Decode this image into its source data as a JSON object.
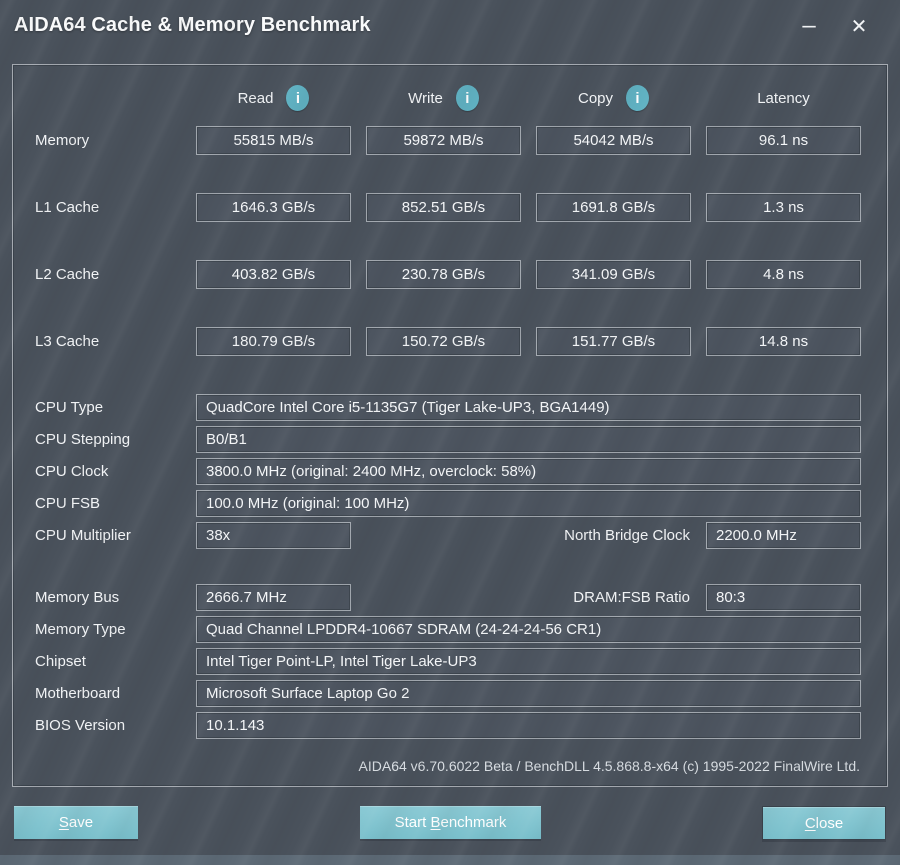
{
  "window": {
    "title": "AIDA64 Cache & Memory Benchmark",
    "minimize_glyph": "–",
    "close_glyph": "✕"
  },
  "colors": {
    "accent_teal": "#7cc1cd",
    "info_icon_teal": "#60b1c2",
    "window_bg": "#4a525c",
    "box_border": "#a2a8af",
    "bottom_strip": "#5d6a76"
  },
  "benchmark": {
    "headers": {
      "read": "Read",
      "write": "Write",
      "copy": "Copy",
      "latency": "Latency",
      "info_glyph": "i"
    },
    "rows": [
      {
        "label": "Memory",
        "read": "55815 MB/s",
        "write": "59872 MB/s",
        "copy": "54042 MB/s",
        "latency": "96.1 ns"
      },
      {
        "label": "L1 Cache",
        "read": "1646.3 GB/s",
        "write": "852.51 GB/s",
        "copy": "1691.8 GB/s",
        "latency": "1.3 ns"
      },
      {
        "label": "L2 Cache",
        "read": "403.82 GB/s",
        "write": "230.78 GB/s",
        "copy": "341.09 GB/s",
        "latency": "4.8 ns"
      },
      {
        "label": "L3 Cache",
        "read": "180.79 GB/s",
        "write": "150.72 GB/s",
        "copy": "151.77 GB/s",
        "latency": "14.8 ns"
      }
    ]
  },
  "cpu_info": {
    "cpu_type": {
      "label": "CPU Type",
      "value": "QuadCore Intel Core i5-1135G7  (Tiger Lake-UP3, BGA1449)"
    },
    "cpu_stepping": {
      "label": "CPU Stepping",
      "value": "B0/B1"
    },
    "cpu_clock": {
      "label": "CPU Clock",
      "value": "3800.0 MHz  (original: 2400 MHz, overclock: 58%)"
    },
    "cpu_fsb": {
      "label": "CPU FSB",
      "value": "100.0 MHz  (original: 100 MHz)"
    },
    "cpu_multiplier": {
      "label": "CPU Multiplier",
      "value": "38x"
    },
    "north_bridge": {
      "label": "North Bridge Clock",
      "value": "2200.0 MHz"
    }
  },
  "memory_info": {
    "memory_bus": {
      "label": "Memory Bus",
      "value": "2666.7 MHz"
    },
    "dram_fsb": {
      "label": "DRAM:FSB Ratio",
      "value": "80:3"
    },
    "memory_type": {
      "label": "Memory Type",
      "value": "Quad Channel LPDDR4-10667 SDRAM  (24-24-24-56 CR1)"
    },
    "chipset": {
      "label": "Chipset",
      "value": "Intel Tiger Point-LP, Intel Tiger Lake-UP3"
    },
    "motherboard": {
      "label": "Motherboard",
      "value": "Microsoft Surface Laptop Go 2"
    },
    "bios_version": {
      "label": "BIOS Version",
      "value": "10.1.143"
    }
  },
  "footer": {
    "credits": "AIDA64 v6.70.6022 Beta / BenchDLL 4.5.868.8-x64  (c) 1995-2022 FinalWire Ltd."
  },
  "buttons": {
    "save": {
      "pre": "",
      "mnemonic": "S",
      "post": "ave"
    },
    "start": {
      "pre": "Start ",
      "mnemonic": "B",
      "post": "enchmark"
    },
    "close": {
      "pre": "",
      "mnemonic": "C",
      "post": "lose"
    }
  }
}
